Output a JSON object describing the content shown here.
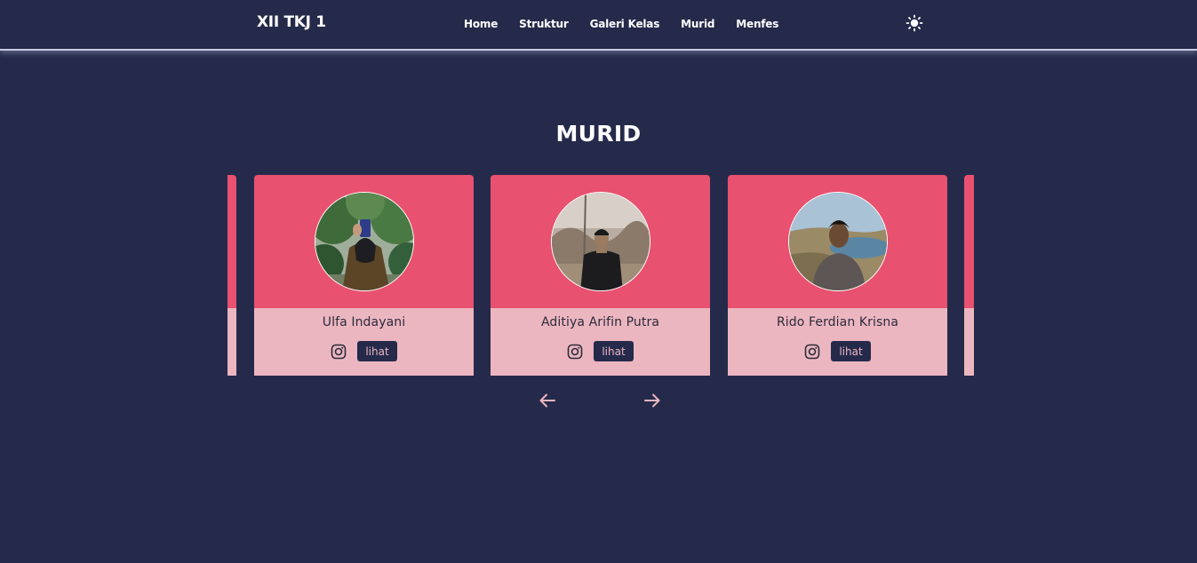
{
  "navbar": {
    "brand": "XII TKJ 1",
    "links": [
      "Home",
      "Struktur",
      "Galeri Kelas",
      "Murid",
      "Menfes"
    ],
    "theme_toggle_icon": "sun-icon"
  },
  "section": {
    "title": "MURID"
  },
  "members": [
    {
      "name": "Ulfa Indayani",
      "button": "lihat",
      "social_icon": "instagram-icon"
    },
    {
      "name": "Aditiya Arifin Putra",
      "button": "lihat",
      "social_icon": "instagram-icon"
    },
    {
      "name": "Rido Ferdian Krisna",
      "button": "lihat",
      "social_icon": "instagram-icon"
    }
  ],
  "carousel": {
    "prev_icon": "arrow-left-icon",
    "next_icon": "arrow-right-icon"
  },
  "colors": {
    "background": "#252a4a",
    "card_top": "#e8516f",
    "card_bottom": "#ecb6c1",
    "button_bg": "#252a4a",
    "arrow": "#ecb6c1"
  }
}
